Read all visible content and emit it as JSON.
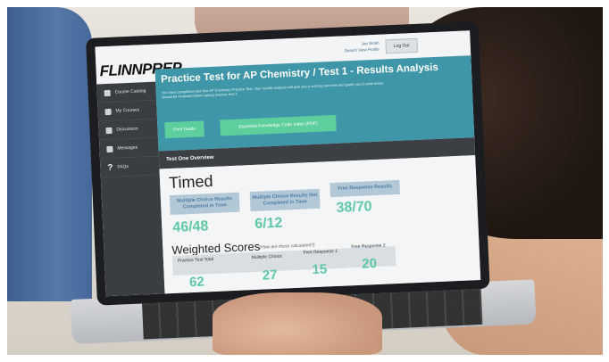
{
  "brand": "FLINNPREP",
  "user": {
    "name": "Joe Smith",
    "links": "Search  View Profile"
  },
  "logout_label": "Log Out",
  "sidebar": {
    "items": [
      {
        "label": "Course Catalog",
        "icon": "book-icon"
      },
      {
        "label": "My Courses",
        "icon": "courses-icon"
      },
      {
        "label": "Discussion",
        "icon": "chat-icon"
      },
      {
        "label": "Messages",
        "icon": "messages-icon"
      },
      {
        "label": "FAQs",
        "icon": "question-icon"
      }
    ]
  },
  "page": {
    "title": "Practice Test for AP Chemistry / Test 1 - Results Analysis",
    "intro": "You have completed your first AP Chemistry Practice Test. Your results analysis will give you a scoring overview and guide you to what areas should be reviewed before taking practice test 2.",
    "print_button": "Print Guide",
    "ekc_button": "Essential Knowledge Code Index (PDF)"
  },
  "overview": {
    "heading": "Test One Overview",
    "timed_title": "Timed",
    "cards": [
      {
        "label": "Multiple Choice Results Completed in Time",
        "value": "46/48"
      },
      {
        "label": "Multiple Choice Results Not Completed in Time",
        "value": "6/12"
      },
      {
        "label": "Free Response Results",
        "value": "38/70"
      }
    ]
  },
  "weighted": {
    "title": "Weighted Scores",
    "note": "(How are these calculated?)",
    "columns": [
      {
        "label": "Practice Test Total",
        "value": "62"
      },
      {
        "label": "Multiple Choice",
        "value": "27"
      },
      {
        "label": "Free Response 1",
        "value": "15"
      },
      {
        "label": "Free Response 2",
        "value": "20"
      }
    ]
  },
  "colors": {
    "header": "#3f96a9",
    "accent_green": "#5ccf9d",
    "sidebar": "#3a3d42",
    "score": "#5ec9a4"
  }
}
